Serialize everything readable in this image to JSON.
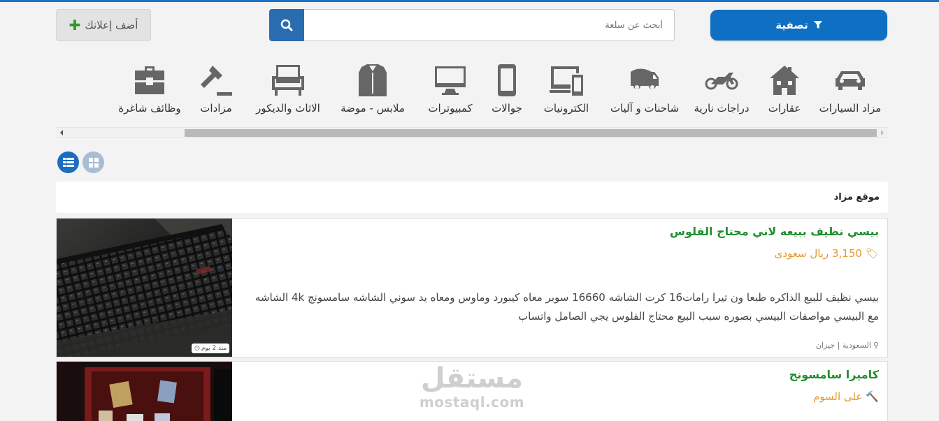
{
  "header": {
    "filter_label": "تصفية",
    "search_placeholder": "أبحث عن سلعة",
    "add_ad_label": "أضف إعلانك"
  },
  "categories": [
    {
      "label": "مزاد السيارات",
      "icon": "car-icon"
    },
    {
      "label": "عقارات",
      "icon": "house-icon"
    },
    {
      "label": "دراجات نارية",
      "icon": "motorcycle-icon"
    },
    {
      "label": "شاحنات و آليات",
      "icon": "truck-icon"
    },
    {
      "label": "الكترونيات",
      "icon": "devices-icon"
    },
    {
      "label": "جوالات",
      "icon": "mobile-icon"
    },
    {
      "label": "كمبيوترات",
      "icon": "desktop-icon"
    },
    {
      "label": "ملابس - موضة",
      "icon": "shirt-icon"
    },
    {
      "label": "الاثاث والديكور",
      "icon": "sofa-icon"
    },
    {
      "label": "مزادات",
      "icon": "gavel-icon"
    },
    {
      "label": "وظائف شاغرة",
      "icon": "briefcase-icon"
    }
  ],
  "section": {
    "title": "موقع مزاد"
  },
  "listings": [
    {
      "title": "بيسي نظيف ببيعه لاني محتاج الفلوس",
      "price": "3,150 ريال سعودى",
      "price_icon": "tag-icon",
      "description": "بيسي نظيف للبيع الذاكره طبعا ون تيرا رامات16 كرت الشاشه 16660 سوبر معاه كيبورد وماوس ومعاه يد سوني الشاشه سامسونج 4k الشاشه مع البيسي مواصفات البيسي بصوره سبب البيع محتاج الفلوس يجي الصامل واتساب",
      "location": "السعودية | جيزان",
      "time_ago": "منذ 2 يوم"
    },
    {
      "title": "كاميرا سامسونج",
      "price": "على السوم",
      "price_icon": "gavel-icon"
    }
  ],
  "watermark": {
    "arabic": "مستقل",
    "latin": "mostaql.com"
  },
  "colors": {
    "primary": "#0f6fc2",
    "green": "#1f8f2e",
    "orange": "#e59a2e"
  }
}
